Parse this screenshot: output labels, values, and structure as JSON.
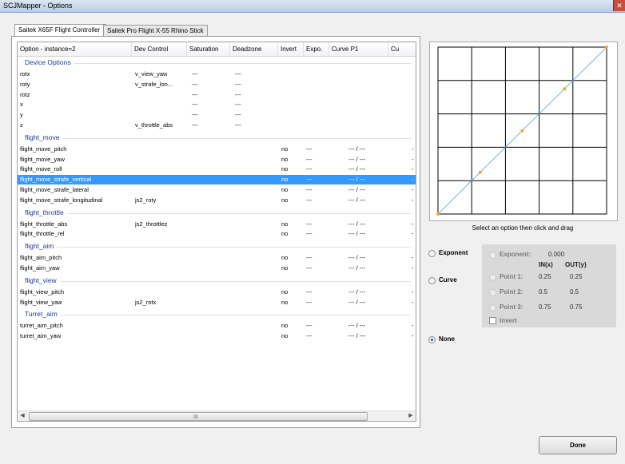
{
  "window": {
    "title": "SCJMapper - Options",
    "close_glyph": "✕"
  },
  "tabs": [
    {
      "label": "Saitek X65F Flight Controller",
      "active": true
    },
    {
      "label": "Saitek Pro Flight X-55 Rhino Stick",
      "active": false
    }
  ],
  "list": {
    "columns": [
      "Option - instance=2",
      "Dev Control",
      "Saturation",
      "Deadzone",
      "Invert",
      "Expo.",
      "Curve P1",
      "Cu"
    ],
    "groups": [
      {
        "name": "Device Options",
        "rows": [
          {
            "option": "rotx",
            "control": "v_view_yaw",
            "saturation": "---",
            "deadzone": "---",
            "invert": "",
            "expo": "",
            "curve": "",
            "cu": ""
          },
          {
            "option": "roty",
            "control": "v_strafe_lon...",
            "saturation": "---",
            "deadzone": "---",
            "invert": "",
            "expo": "",
            "curve": "",
            "cu": ""
          },
          {
            "option": "rotz",
            "control": "",
            "saturation": "---",
            "deadzone": "---",
            "invert": "",
            "expo": "",
            "curve": "",
            "cu": ""
          },
          {
            "option": "x",
            "control": "",
            "saturation": "---",
            "deadzone": "---",
            "invert": "",
            "expo": "",
            "curve": "",
            "cu": ""
          },
          {
            "option": "y",
            "control": "",
            "saturation": "---",
            "deadzone": "---",
            "invert": "",
            "expo": "",
            "curve": "",
            "cu": ""
          },
          {
            "option": "z",
            "control": "v_throttle_abs",
            "saturation": "---",
            "deadzone": "---",
            "invert": "",
            "expo": "",
            "curve": "",
            "cu": ""
          }
        ]
      },
      {
        "name": "flight_move",
        "rows": [
          {
            "option": "flight_move_pitch",
            "control": "",
            "saturation": "",
            "deadzone": "",
            "invert": "no",
            "expo": "---",
            "curve": "--- / ---",
            "cu": "-"
          },
          {
            "option": "flight_move_yaw",
            "control": "",
            "saturation": "",
            "deadzone": "",
            "invert": "no",
            "expo": "---",
            "curve": "--- / ---",
            "cu": "-"
          },
          {
            "option": "flight_move_roll",
            "control": "",
            "saturation": "",
            "deadzone": "",
            "invert": "no",
            "expo": "---",
            "curve": "--- / ---",
            "cu": "-"
          },
          {
            "option": "flight_move_strafe_vertical",
            "control": "",
            "saturation": "",
            "deadzone": "",
            "invert": "no",
            "expo": "---",
            "curve": "--- / ---",
            "cu": "-",
            "selected": true
          },
          {
            "option": "flight_move_strafe_lateral",
            "control": "",
            "saturation": "",
            "deadzone": "",
            "invert": "no",
            "expo": "---",
            "curve": "--- / ---",
            "cu": "-"
          },
          {
            "option": "flight_move_strafe_longitudinal",
            "control": "js2_roty",
            "saturation": "",
            "deadzone": "",
            "invert": "no",
            "expo": "---",
            "curve": "--- / ---",
            "cu": "-"
          }
        ]
      },
      {
        "name": "flight_throttle",
        "rows": [
          {
            "option": "flight_throttle_abs",
            "control": "js2_throttlez",
            "saturation": "",
            "deadzone": "",
            "invert": "no",
            "expo": "---",
            "curve": "--- / ---",
            "cu": "-"
          },
          {
            "option": "flight_throttle_rel",
            "control": "",
            "saturation": "",
            "deadzone": "",
            "invert": "no",
            "expo": "---",
            "curve": "--- / ---",
            "cu": "-"
          }
        ]
      },
      {
        "name": "flight_aim",
        "rows": [
          {
            "option": "flight_aim_pitch",
            "control": "",
            "saturation": "",
            "deadzone": "",
            "invert": "no",
            "expo": "---",
            "curve": "--- / ---",
            "cu": "-"
          },
          {
            "option": "flight_aim_yaw",
            "control": "",
            "saturation": "",
            "deadzone": "",
            "invert": "no",
            "expo": "---",
            "curve": "--- / ---",
            "cu": "-"
          }
        ]
      },
      {
        "name": "flight_view",
        "rows": [
          {
            "option": "flight_view_pitch",
            "control": "",
            "saturation": "",
            "deadzone": "",
            "invert": "no",
            "expo": "---",
            "curve": "--- / ---",
            "cu": "-"
          },
          {
            "option": "flight_view_yaw",
            "control": "js2_rotx",
            "saturation": "",
            "deadzone": "",
            "invert": "no",
            "expo": "---",
            "curve": "--- / ---",
            "cu": "-"
          }
        ]
      },
      {
        "name": "Turret_aim",
        "rows": [
          {
            "option": "turret_aim_pitch",
            "control": "",
            "saturation": "",
            "deadzone": "",
            "invert": "no",
            "expo": "---",
            "curve": "--- / ---",
            "cu": "-"
          },
          {
            "option": "turret_aim_yaw",
            "control": "",
            "saturation": "",
            "deadzone": "",
            "invert": "no",
            "expo": "---",
            "curve": "--- / ---",
            "cu": "-"
          }
        ]
      }
    ],
    "scrollbar_grip": "III"
  },
  "curve_graph": {
    "hint": "Select an option then click and drag",
    "points": [
      [
        0,
        0
      ],
      [
        0.25,
        0.25
      ],
      [
        0.5,
        0.5
      ],
      [
        0.75,
        0.75
      ],
      [
        1,
        1
      ]
    ],
    "line_color": "#7fb3e0",
    "point_color": "#f5a623"
  },
  "modes": {
    "exponent": {
      "label": "Exponent",
      "checked": false
    },
    "curve": {
      "label": "Curve",
      "checked": false
    },
    "none": {
      "label": "None",
      "checked": true
    }
  },
  "options_panel": {
    "exponent_label": "Exponent:",
    "exponent_value": "0.000",
    "in_header": "IN(x)",
    "out_header": "OUT(y)",
    "points": [
      {
        "label": "Point 1:",
        "in": "0.25",
        "out": "0.25"
      },
      {
        "label": "Point 2:",
        "in": "0.5",
        "out": "0.5"
      },
      {
        "label": "Point 3:",
        "in": "0.75",
        "out": "0.75"
      }
    ],
    "invert_label": "Invert",
    "invert_checked": false
  },
  "done_button": {
    "label": "Done"
  }
}
